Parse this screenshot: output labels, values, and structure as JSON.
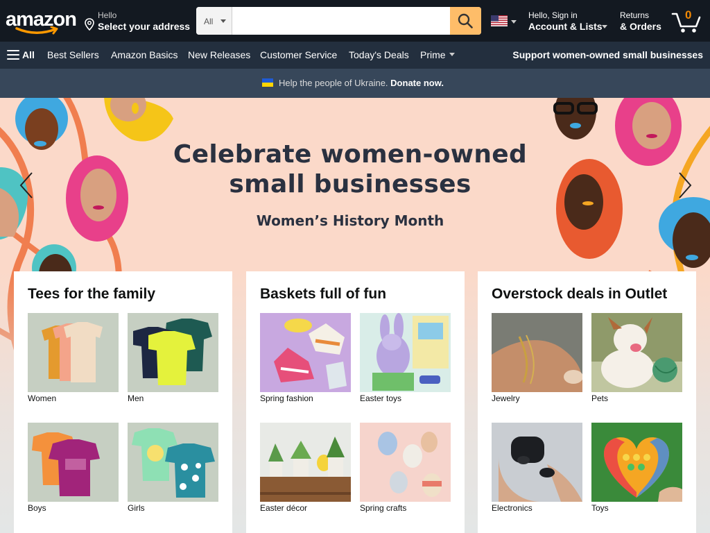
{
  "header": {
    "logo_text": "amazon",
    "address": {
      "greeting": "Hello",
      "action": "Select your address"
    },
    "search": {
      "category": "All",
      "placeholder": "",
      "value": ""
    },
    "language_flag": "us-flag-icon",
    "account": {
      "line1": "Hello, Sign in",
      "line2": "Account & Lists"
    },
    "orders": {
      "line1": "Returns",
      "line2": "& Orders"
    },
    "cart": {
      "count": "0"
    }
  },
  "nav": {
    "all_label": "All",
    "links": [
      "Best Sellers",
      "Amazon Basics",
      "New Releases",
      "Customer Service",
      "Today's Deals",
      "Prime"
    ],
    "promo": "Support women-owned small businesses"
  },
  "banner": {
    "text": "Help the people of Ukraine.",
    "link": "Donate now."
  },
  "hero": {
    "title_line1": "Celebrate women-owned",
    "title_line2": "small businesses",
    "subtitle": "Women’s History Month"
  },
  "cards": [
    {
      "title": "Tees for the family",
      "tiles": [
        "Women",
        "Men",
        "Boys",
        "Girls"
      ]
    },
    {
      "title": "Baskets full of fun",
      "tiles": [
        "Spring fashion",
        "Easter toys",
        "Easter décor",
        "Spring crafts"
      ]
    },
    {
      "title": "Overstock deals in Outlet",
      "tiles": [
        "Jewelry",
        "Pets",
        "Electronics",
        "Toys"
      ]
    }
  ],
  "colors": {
    "nav_dark": "#131921",
    "nav_main": "#232f3e",
    "banner": "#37475a",
    "search_button": "#febd69",
    "cart_count": "#f08804",
    "hero_bg": "#fbd9c9"
  }
}
